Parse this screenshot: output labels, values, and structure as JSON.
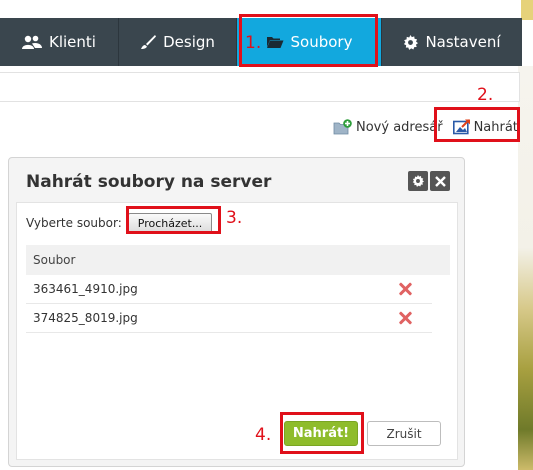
{
  "nav": {
    "items": [
      {
        "label": "Klienti",
        "icon": "users-icon"
      },
      {
        "label": "Design",
        "icon": "brush-icon"
      },
      {
        "label": "Soubory",
        "icon": "folder-open-icon",
        "active": true
      },
      {
        "label": "Nastavení",
        "icon": "gear-icon"
      }
    ],
    "active_color": "#12a8de",
    "bar_color": "#3a464e"
  },
  "actions": {
    "new_folder_label": "Nový adresář",
    "upload_label": "Nahrát"
  },
  "dialog": {
    "title": "Nahrát soubory na server",
    "file_label": "Vyberte soubor:",
    "browse_label": "Procházet...",
    "table_header": "Soubor",
    "files": [
      "363461_4910.jpg",
      "374825_8019.jpg"
    ],
    "submit_label": "Nahrát!",
    "cancel_label": "Zrušit"
  },
  "annotations": [
    "1.",
    "2.",
    "3.",
    "4."
  ]
}
